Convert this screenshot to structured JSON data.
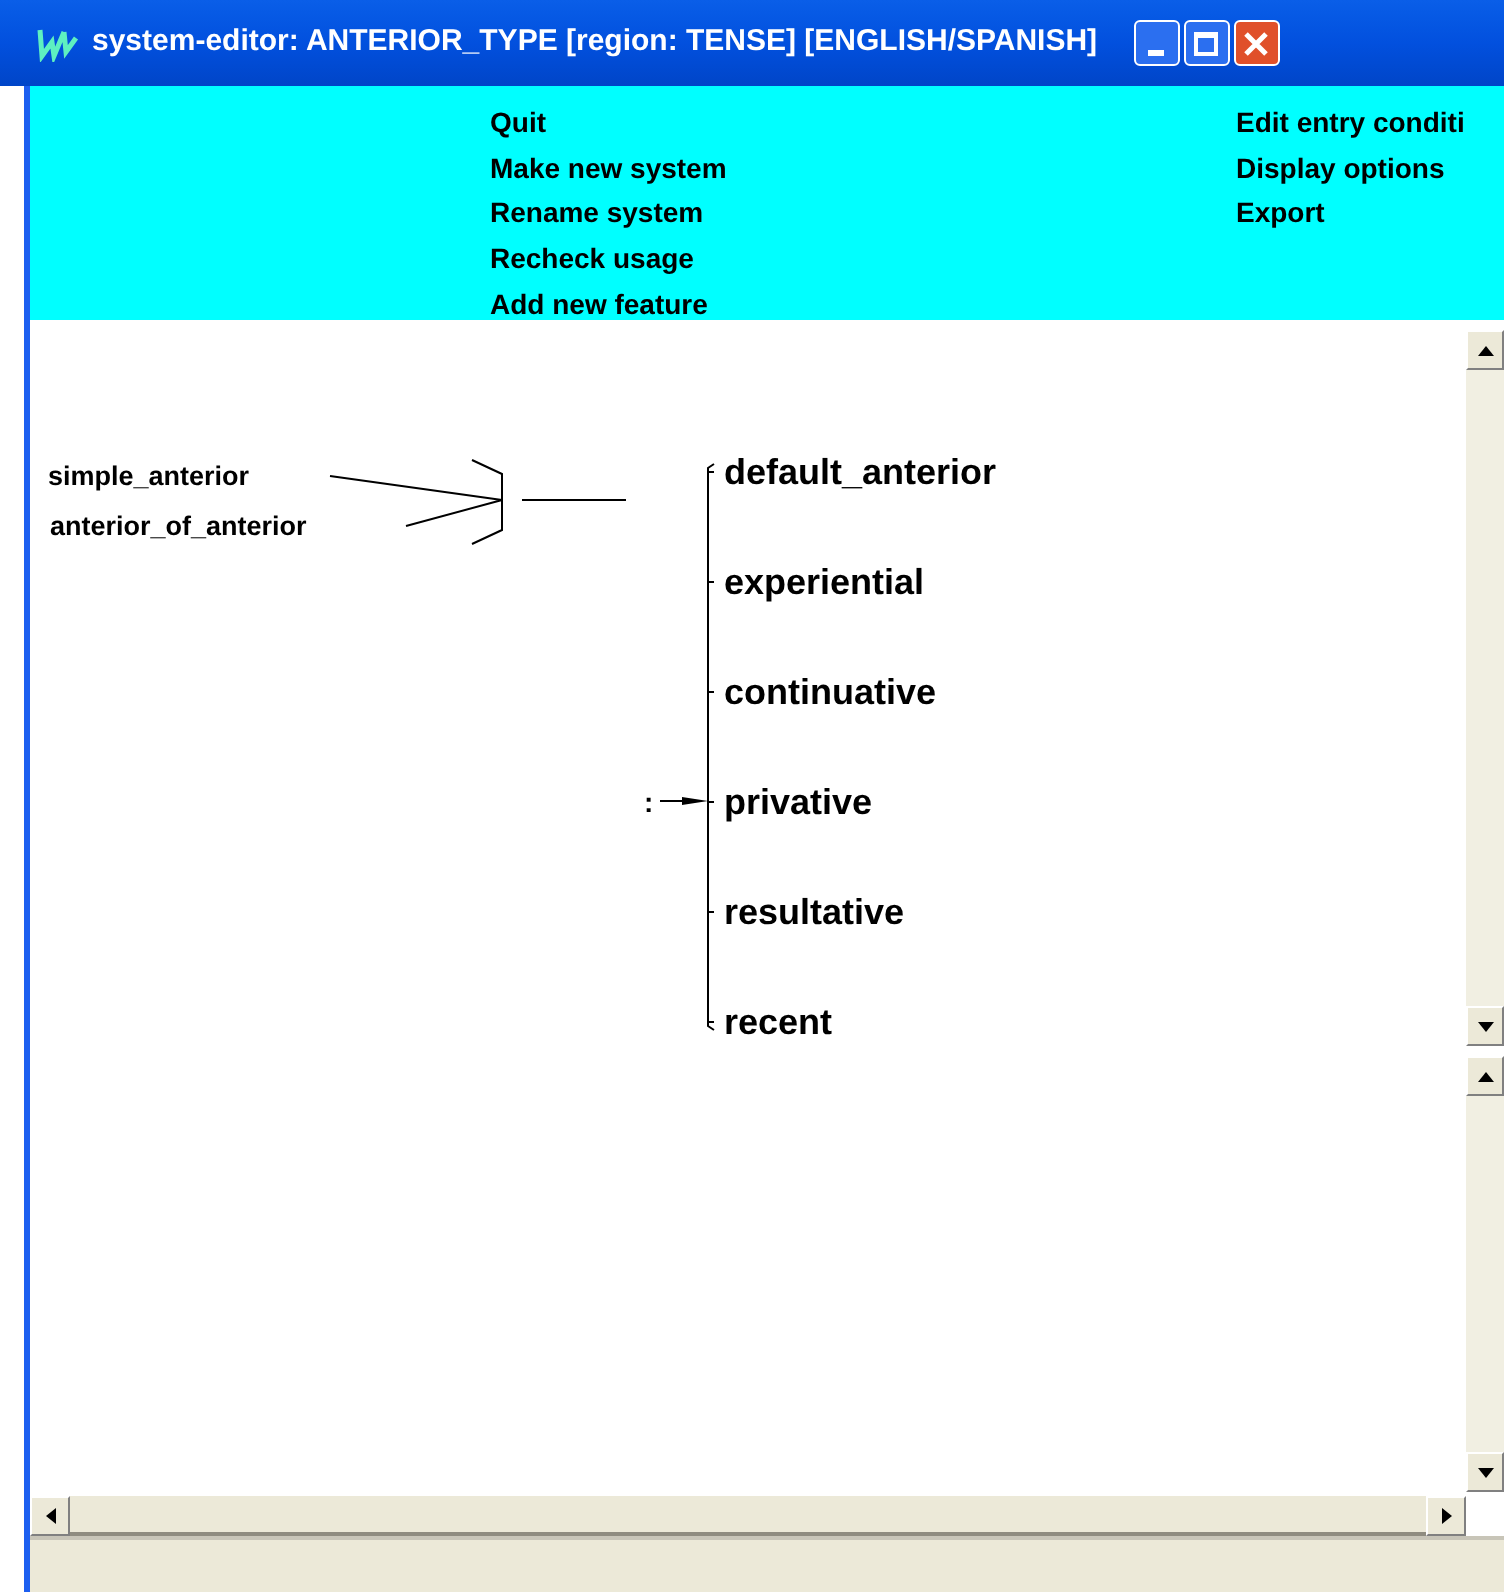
{
  "window": {
    "title": "system-editor: ANTERIOR_TYPE [region: TENSE] [ENGLISH/SPANISH]"
  },
  "menu": {
    "columns": [
      {
        "items": [
          "Quit",
          "Make new system",
          "Rename system",
          "Recheck usage",
          "Add new feature"
        ]
      },
      {
        "items": [
          "Edit entry conditi",
          "Display options",
          "Export"
        ]
      }
    ]
  },
  "diagram": {
    "entry_conditions": [
      "simple_anterior",
      "anterior_of_anterior"
    ],
    "entry_marker": ":",
    "features": [
      "default_anterior",
      "experiential",
      "continuative",
      "privative",
      "resultative",
      "recent"
    ]
  }
}
